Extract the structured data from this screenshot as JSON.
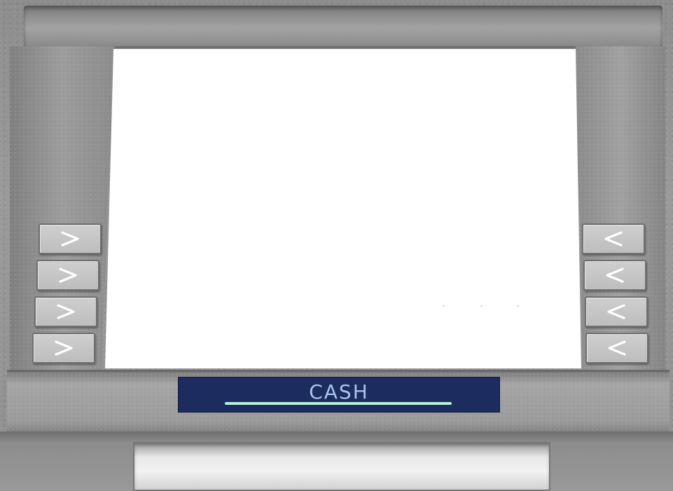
{
  "atm": {
    "display_label": "CASH",
    "colors": {
      "display_background": "#1c2c5e",
      "display_text": "#a8c4ec",
      "cash_slot": "#b7f0d8",
      "screen": "#ffffff",
      "body": "#9a9a9a"
    },
    "left_buttons": [
      {
        "icon": "chevron-right-icon"
      },
      {
        "icon": "chevron-right-icon"
      },
      {
        "icon": "chevron-right-icon"
      },
      {
        "icon": "chevron-right-icon"
      }
    ],
    "right_buttons": [
      {
        "icon": "chevron-left-icon"
      },
      {
        "icon": "chevron-left-icon"
      },
      {
        "icon": "chevron-left-icon"
      },
      {
        "icon": "chevron-left-icon"
      }
    ]
  }
}
